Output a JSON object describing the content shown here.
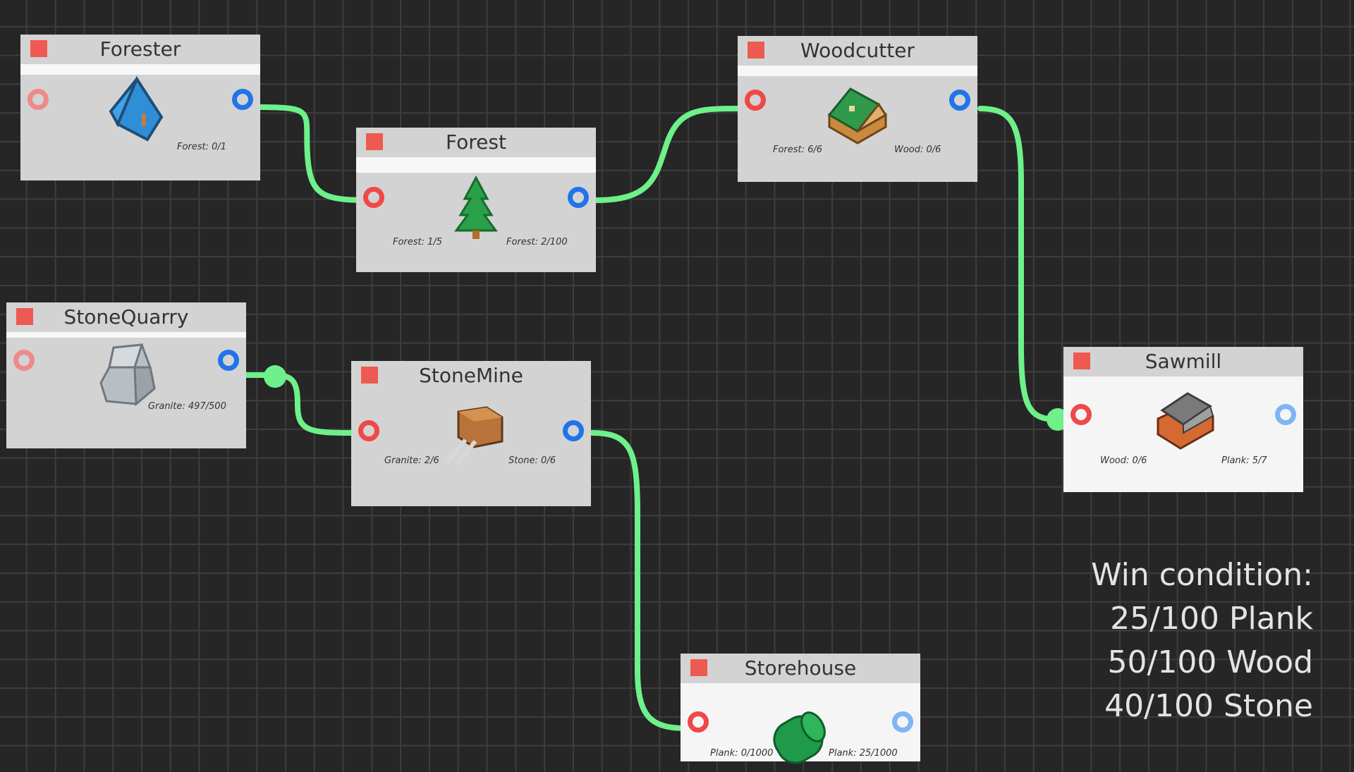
{
  "nodes": {
    "forester": {
      "title": "Forester",
      "outputs": "Forest: 0/1"
    },
    "forest": {
      "title": "Forest",
      "inputs": "Forest: 1/5",
      "outputs": "Forest: 2/100"
    },
    "woodcutter": {
      "title": "Woodcutter",
      "inputs": "Forest: 6/6",
      "outputs": "Wood: 0/6"
    },
    "stonequarry": {
      "title": "StoneQuarry",
      "outputs": "Granite: 497/500"
    },
    "stonemine": {
      "title": "StoneMine",
      "inputs": "Granite: 2/6",
      "outputs": "Stone: 0/6"
    },
    "sawmill": {
      "title": "Sawmill",
      "inputs": "Wood: 0/6",
      "outputs": "Plank: 5/7"
    },
    "storehouse": {
      "title": "Storehouse",
      "inputs": "Plank: 0/1000",
      "outputs": "Plank: 25/1000"
    }
  },
  "win_condition": {
    "title": "Win condition:",
    "lines": [
      "25/100 Plank",
      "50/100 Wood",
      "40/100 Stone"
    ]
  },
  "icons": {
    "forester": "blue-tent-icon",
    "forest": "pine-tree-icon",
    "woodcutter": "wood-cabin-icon",
    "stonequarry": "rock-icon",
    "stonemine": "mine-cart-icon",
    "sawmill": "sawmill-building-icon",
    "storehouse": "storage-barrel-icon"
  },
  "colors": {
    "background": "#262626",
    "grid": "#3d3d3d",
    "wire": "#6ef08a",
    "input_port": "#f04848",
    "output_port": "#1f74ea",
    "stop_button": "#ee5a52"
  }
}
